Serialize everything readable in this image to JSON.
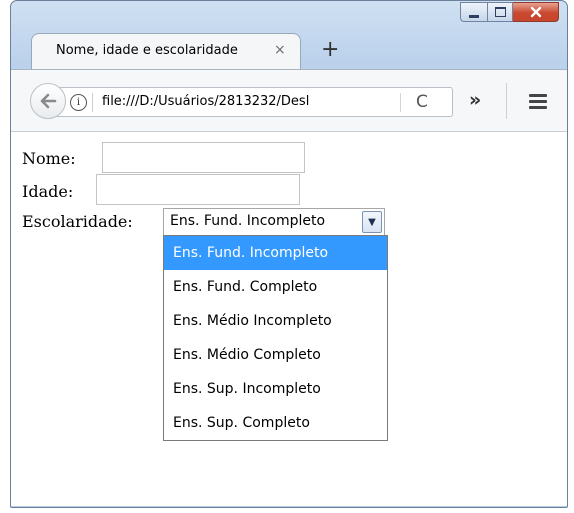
{
  "window": {
    "controls": {
      "minimize": "minimize-icon",
      "maximize": "maximize-icon",
      "close": "close-icon"
    }
  },
  "tabs": [
    {
      "title": "Nome, idade e escolaridade",
      "close_symbol": "×"
    }
  ],
  "new_tab_symbol": "+",
  "toolbar": {
    "url": "file:///D:/Usuários/2813232/Desl",
    "info_symbol": "i",
    "reload_symbol": "C",
    "overflow_symbol": "»"
  },
  "form": {
    "nome_label": "Nome:",
    "nome_value": "",
    "idade_label": "Idade:",
    "idade_value": "",
    "escolaridade_label": "Escolaridade:",
    "escolaridade_selected": "Ens. Fund. Incompleto",
    "escolaridade_options": [
      "Ens. Fund. Incompleto",
      "Ens. Fund. Completo",
      "Ens. Médio Incompleto",
      "Ens. Médio Completo",
      "Ens. Sup. Incompleto",
      "Ens. Sup. Completo"
    ],
    "highlighted_option": "Ens. Fund. Incompleto"
  },
  "colors": {
    "highlight": "#3399ff",
    "close_button": "#c9492f"
  }
}
